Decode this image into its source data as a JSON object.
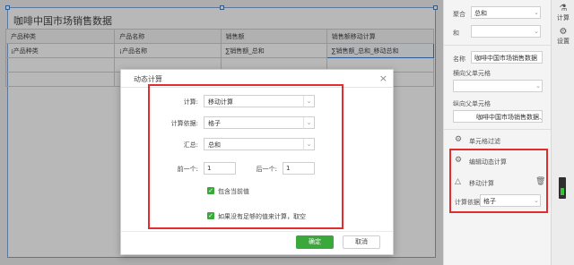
{
  "report": {
    "title": "咖啡中国市场销售数据",
    "headers": [
      "产品种类",
      "产品名称",
      "销售额",
      "销售额移动计算"
    ],
    "row": [
      "¡产品种类",
      "¡产品名称",
      "∑销售额_总和",
      "∑销售额_总和_移动总和"
    ]
  },
  "dialog": {
    "title": "动态计算",
    "close": "×",
    "calc_label": "计算:",
    "calc_value": "移动计算",
    "basis_label": "计算依据:",
    "basis_value": "格子",
    "summary_label": "汇总:",
    "summary_value": "总和",
    "prev_label": "前一个:",
    "prev_value": "1",
    "next_label": "后一个:",
    "next_value": "1",
    "check1": "包含当前值",
    "check2": "如果没有足够的值来计算，取空",
    "ok": "确定",
    "cancel": "取消"
  },
  "panel": {
    "aggregate_label": "聚合",
    "aggregate_value": "总和",
    "and_label": "和",
    "name_label": "名称",
    "name_value": "咖啡中国市场销售数据",
    "h_parent_label": "横向父单元格",
    "v_parent_label": "纵向父单元格",
    "v_parent_value": "咖啡中国市场销售数据.产",
    "cell_filter": "单元格过滤",
    "edit_dynamic": "编辑动态计算",
    "moving_calc": "移动计算",
    "basis_label": "计算依据",
    "basis_value": "格子"
  },
  "rail": {
    "calc": "计算",
    "settings": "设置"
  },
  "colors": {
    "accent_green": "#3aa83a",
    "highlight_red": "#e02d2d",
    "selection_blue": "#3d7fd0"
  }
}
